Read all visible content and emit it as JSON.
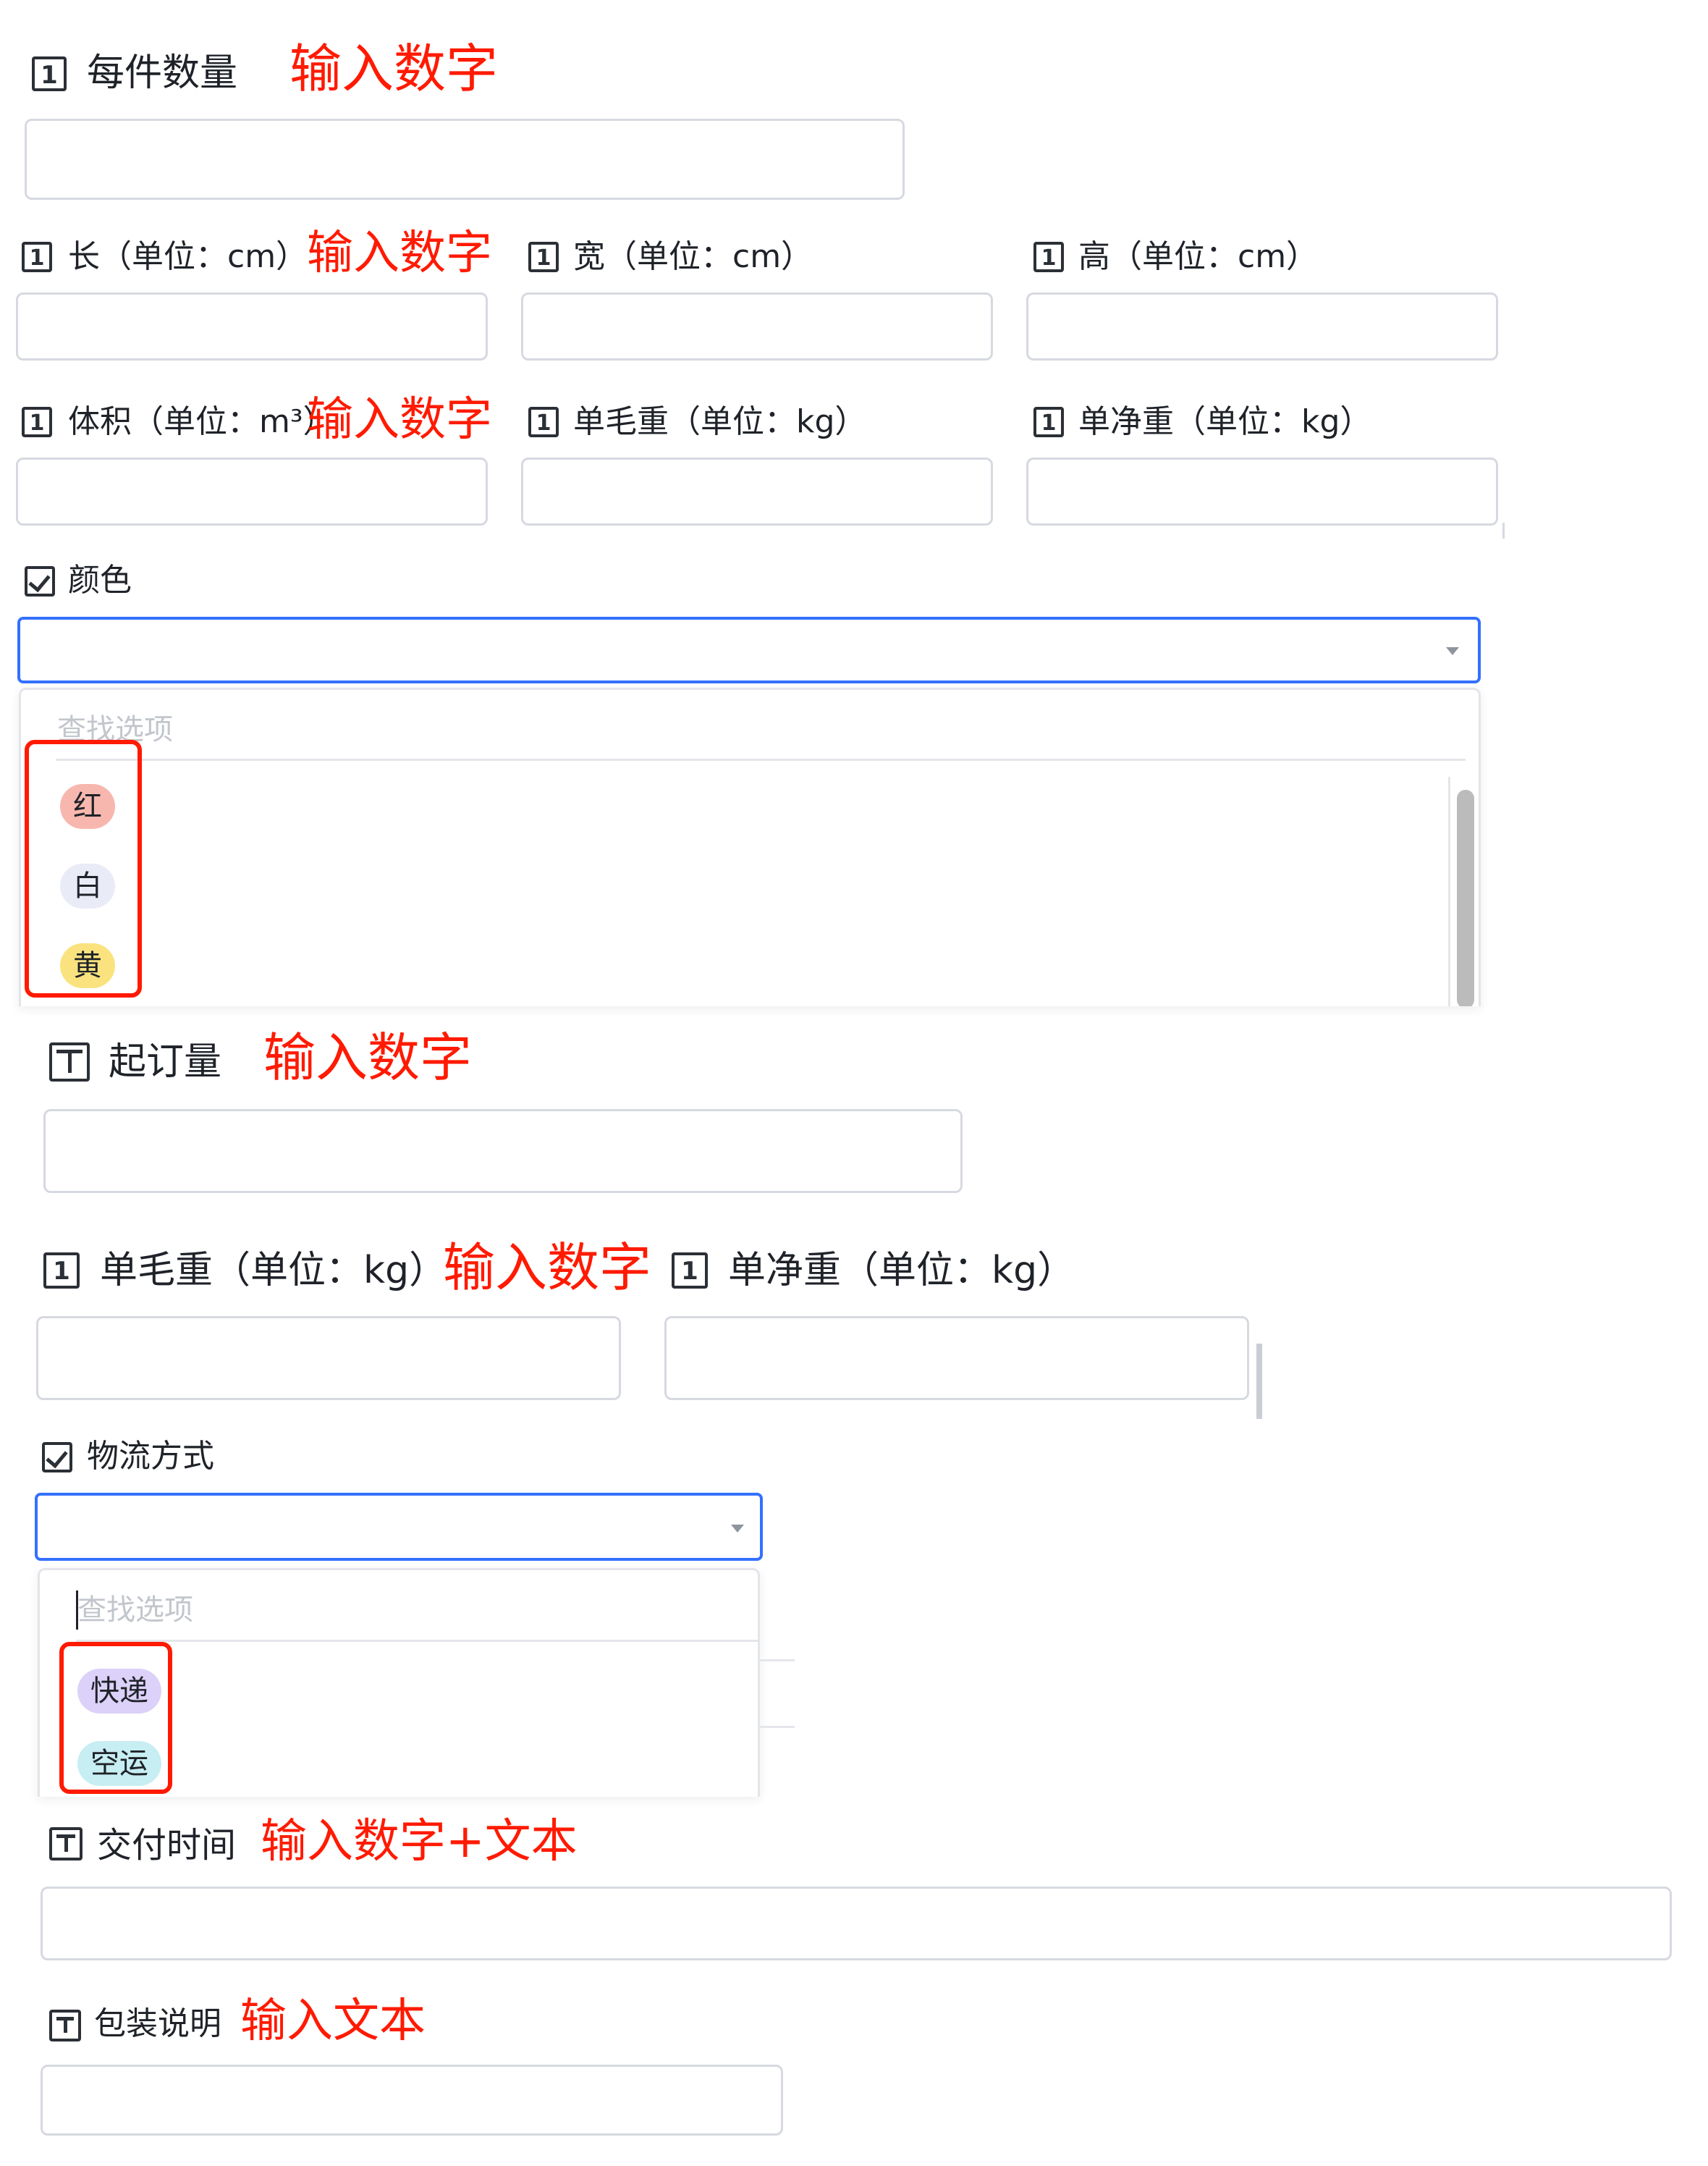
{
  "screen1": {
    "piece_qty": {
      "label": "每件数量",
      "note": "输入数字"
    },
    "length": {
      "label": "长（单位：cm）",
      "note": "输入数字"
    },
    "width": {
      "label": "宽（单位：cm）"
    },
    "height": {
      "label": "高（单位：cm）"
    },
    "volume": {
      "label": "体积（单位：m³）",
      "note": "输入数字"
    },
    "gross_weight": {
      "label": "单毛重（单位：kg）"
    },
    "net_weight": {
      "label": "单净重（单位：kg）"
    },
    "color": {
      "label": "颜色",
      "search_placeholder": "查找选项",
      "options": [
        "红",
        "白",
        "黄"
      ]
    }
  },
  "screen2": {
    "moq": {
      "label": "起订量",
      "note": "输入数字"
    },
    "gross_weight": {
      "label": "单毛重（单位：kg）",
      "note": "输入数字"
    },
    "net_weight": {
      "label": "单净重（单位：kg）"
    },
    "logistics": {
      "label": "物流方式",
      "search_placeholder": "查找选项",
      "options": [
        "快递",
        "空运"
      ]
    },
    "delivery_time": {
      "label": "交付时间",
      "note": "输入数字+文本"
    },
    "packaging": {
      "label": "包装说明",
      "note": "输入文本"
    }
  },
  "colors": {
    "accent": "#3370ff",
    "annotation": "#ff1a00",
    "tag_red": "#f8b7ae",
    "tag_white": "#e9ebf7",
    "tag_yellow": "#fae37f",
    "tag_purple": "#dcd1f8",
    "tag_cyan": "#c7eef2"
  },
  "icons": {
    "number_field": "number-icon",
    "text_field": "text-icon",
    "multi_select": "checkbox-icon"
  }
}
